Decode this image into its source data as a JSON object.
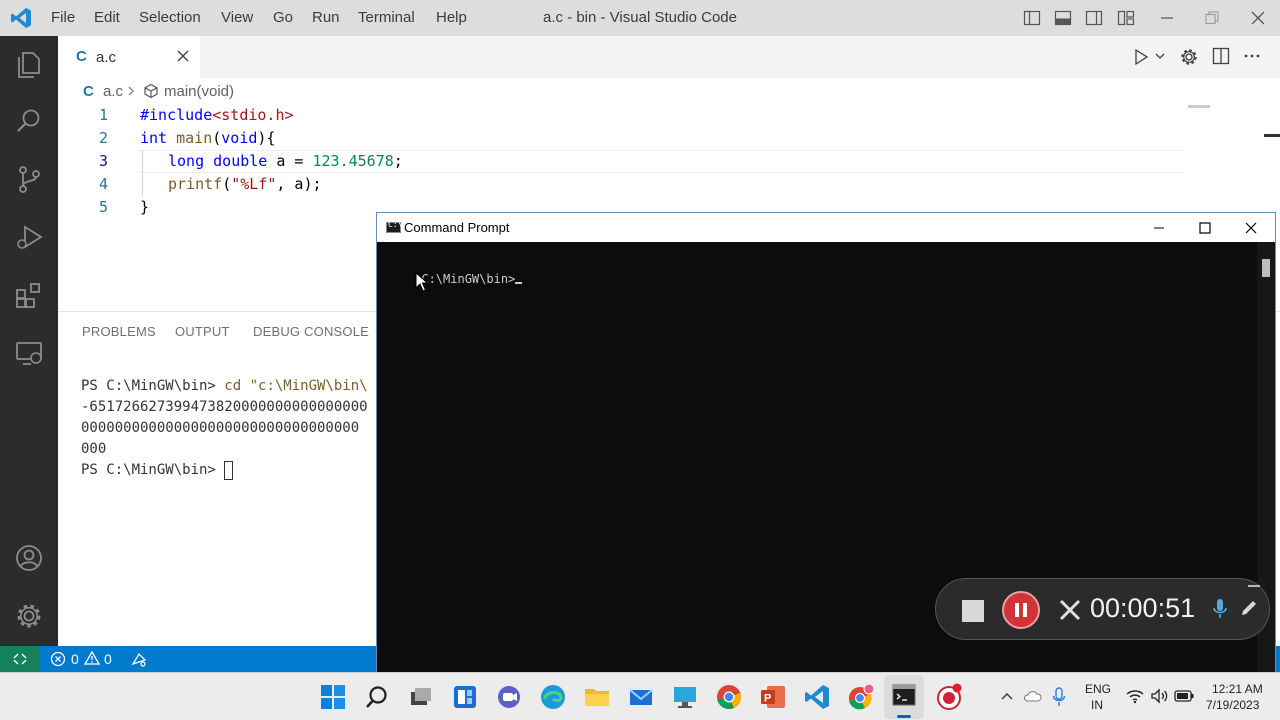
{
  "window": {
    "title": "a.c - bin - Visual Studio Code",
    "menu": [
      "File",
      "Edit",
      "Selection",
      "View",
      "Go",
      "Run",
      "Terminal",
      "Help"
    ]
  },
  "editor": {
    "tab_icon": "C",
    "tab_label": "a.c",
    "breadcrumb": {
      "file_icon": "C",
      "file": "a.c",
      "symbol": "main(void)"
    },
    "line_numbers": [
      "1",
      "2",
      "3",
      "4",
      "5"
    ],
    "code": {
      "l1_pp": "#include",
      "l1_inc": "<stdio.h>",
      "l2_kw": "int",
      "l2_fn": "main",
      "l2_rest1": "(",
      "l2_kw2": "void",
      "l2_rest2": "){",
      "l3_kw": "long double",
      "l3_mid": " a = ",
      "l3_num": "123.45678",
      "l3_end": ";",
      "l4_fn": "printf",
      "l4_open": "(",
      "l4_str": "\"%Lf\"",
      "l4_end": ", a);",
      "l5": "}"
    }
  },
  "panel": {
    "tabs": [
      "PROBLEMS",
      "OUTPUT",
      "DEBUG CONSOLE"
    ],
    "terminal_lines": [
      "PS C:\\MinGW\\bin> ",
      "-651726627399473820000000000000000",
      "000000000000000000000000000000000",
      "000",
      "PS C:\\MinGW\\bin> "
    ],
    "cd_command": "cd \"c:\\MinGW\\bin\\"
  },
  "statusbar": {
    "errors": "0",
    "warnings": "0"
  },
  "cmd": {
    "title": "Command Prompt",
    "prompt": "C:\\MinGW\\bin>"
  },
  "recorder": {
    "time": "00:00:51"
  },
  "taskbar": {
    "lang_top": "ENG",
    "lang_bottom": "IN",
    "time": "12:21 AM",
    "date": "7/19/2023"
  },
  "colors": {
    "accent": "#007acc",
    "remote": "#16825d",
    "activity_bar": "#2c2c2c",
    "record_red": "#d13438"
  }
}
